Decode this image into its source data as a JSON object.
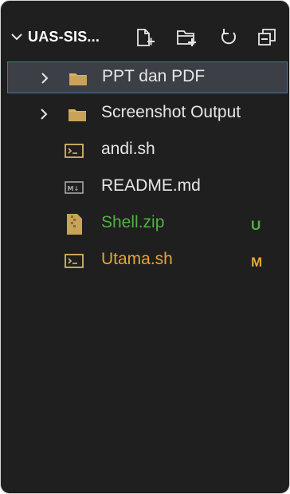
{
  "explorer": {
    "title": "UAS-SIS...",
    "actions": {
      "new_file": "new-file-icon",
      "new_folder": "new-folder-icon",
      "refresh": "refresh-icon",
      "collapse_all": "collapse-all-icon"
    }
  },
  "tree": {
    "items": [
      {
        "label": "PPT dan PDF",
        "type": "folder",
        "expanded": false,
        "selected": true,
        "badge": "",
        "color": "#e6e6e6"
      },
      {
        "label": "Screenshot Output",
        "type": "folder",
        "expanded": false,
        "selected": false,
        "badge": "",
        "color": "#e6e6e6"
      },
      {
        "label": "andi.sh",
        "type": "shell",
        "selected": false,
        "badge": "",
        "color": "#e6e6e6"
      },
      {
        "label": "README.md",
        "type": "markdown",
        "selected": false,
        "badge": "",
        "color": "#e6e6e6"
      },
      {
        "label": "Shell.zip",
        "type": "zip",
        "selected": false,
        "badge": "U",
        "color": "#4fb23f"
      },
      {
        "label": "Utama.sh",
        "type": "shell",
        "selected": false,
        "badge": "M",
        "color": "#e3a53a"
      }
    ]
  },
  "colors": {
    "background": "#1f1f1f",
    "selection_bg": "#3c4046",
    "selection_border": "#4a6fa8",
    "untracked": "#4fb23f",
    "modified": "#e3a53a",
    "folder": "#d8b46a"
  }
}
